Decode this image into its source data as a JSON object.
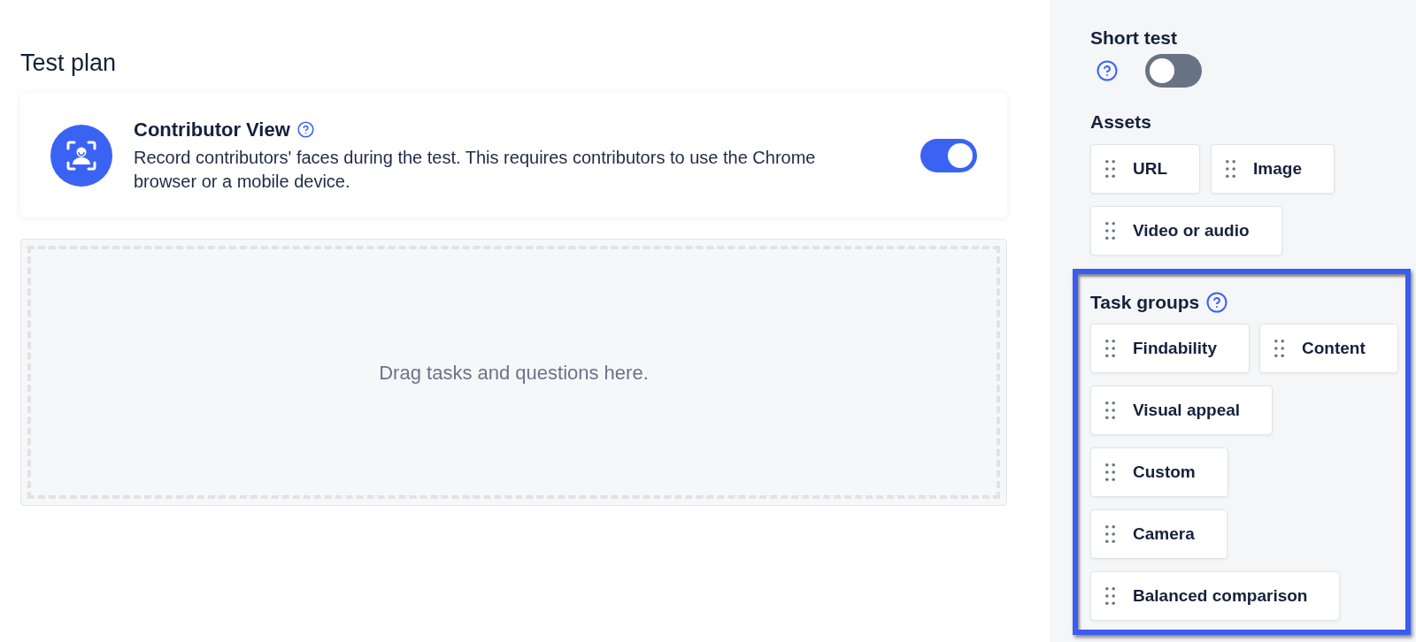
{
  "main": {
    "title": "Test plan",
    "contributor_view": {
      "title": "Contributor View",
      "description": "Record contributors' faces during the test. This requires contributors to use the Chrome browser or a mobile device.",
      "on": true
    },
    "drop_zone": {
      "text": "Drag tasks and questions here."
    }
  },
  "sidebar": {
    "short_test": {
      "label": "Short test",
      "on": false
    },
    "assets": {
      "heading": "Assets",
      "rows": [
        [
          {
            "label": "URL"
          },
          {
            "label": "Image"
          }
        ],
        [
          {
            "label": "Video or audio"
          }
        ]
      ]
    },
    "task_groups": {
      "heading": "Task groups",
      "highlighted": true,
      "rows": [
        [
          {
            "label": "Findability"
          },
          {
            "label": "Content"
          }
        ],
        [
          {
            "label": "Visual appeal"
          }
        ],
        [
          {
            "label": "Custom"
          }
        ],
        [
          {
            "label": "Camera"
          }
        ],
        [
          {
            "label": "Balanced comparison"
          }
        ]
      ]
    }
  }
}
